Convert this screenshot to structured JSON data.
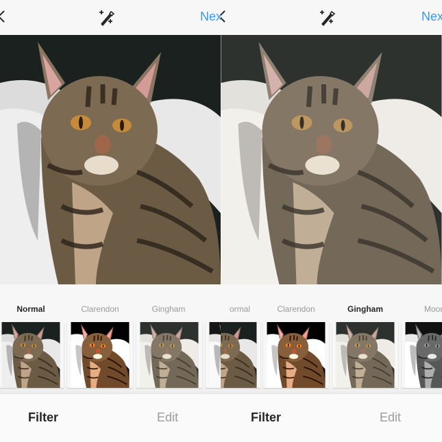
{
  "screens": [
    {
      "topbar": {
        "back_icon": "chevron-left-icon",
        "lux_icon": "magic-wand-icon",
        "next_label": "Nex"
      },
      "photo": {
        "subject": "tabby kitten on white blanket",
        "filter_applied": "Normal"
      },
      "filters": [
        {
          "name": "Normal",
          "selected": true
        },
        {
          "name": "Clarendon",
          "selected": false
        },
        {
          "name": "Gingham",
          "selected": false
        }
      ],
      "tabs": {
        "filter_label": "Filter",
        "edit_label": "Edit",
        "active": "Filter"
      }
    },
    {
      "topbar": {
        "back_icon": "chevron-left-icon",
        "lux_icon": "magic-wand-icon",
        "next_label": "Nex"
      },
      "photo": {
        "subject": "tabby kitten on white blanket",
        "filter_applied": "Gingham"
      },
      "filters": [
        {
          "name": "ormal",
          "selected": false
        },
        {
          "name": "Clarendon",
          "selected": false
        },
        {
          "name": "Gingham",
          "selected": true
        },
        {
          "name": "Moon",
          "selected": false
        }
      ],
      "tabs": {
        "filter_label": "Filter",
        "edit_label": "Edit",
        "active": "Filter"
      }
    }
  ],
  "colors": {
    "accent": "#3897f0",
    "text_active": "#262626",
    "text_inactive": "#9b9b9b",
    "background": "#f7f7f7"
  }
}
